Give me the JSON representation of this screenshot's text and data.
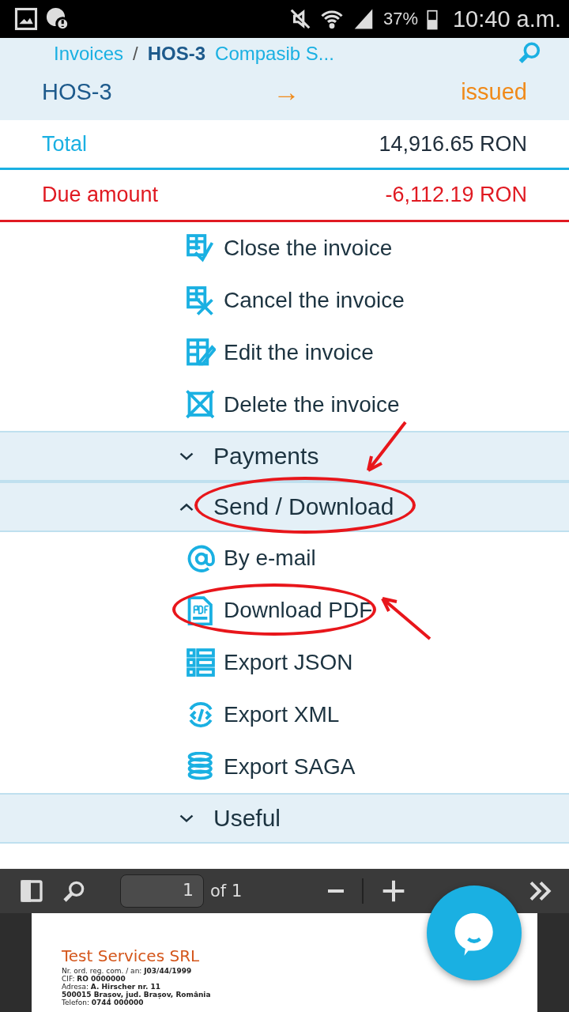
{
  "status_bar": {
    "battery": "37%",
    "time": "10:40 a.m."
  },
  "breadcrumb": {
    "parent": "Invoices",
    "separator": "/",
    "number": "HOS-3",
    "client": "Compasib S..."
  },
  "invoice": {
    "number": "HOS-3",
    "arrow": "→",
    "status": "issued"
  },
  "totals": [
    {
      "kind": "total",
      "label": "Total",
      "value": "14,916.65 RON"
    },
    {
      "kind": "due",
      "label": "Due amount",
      "value": "-6,112.19 RON"
    }
  ],
  "actions": [
    {
      "label": "Close the invoice"
    },
    {
      "label": "Cancel the invoice"
    },
    {
      "label": "Edit the invoice"
    },
    {
      "label": "Delete the invoice"
    }
  ],
  "sections": [
    {
      "title": "Payments",
      "expanded": false,
      "highlighted": false
    },
    {
      "title": "Send / Download",
      "expanded": true,
      "highlighted": true,
      "items": [
        {
          "label": "By e-mail",
          "highlighted": false
        },
        {
          "label": "Download PDF",
          "highlighted": true
        },
        {
          "label": "Export JSON",
          "highlighted": false
        },
        {
          "label": "Export XML",
          "highlighted": false
        },
        {
          "label": "Export SAGA",
          "highlighted": false
        }
      ]
    },
    {
      "title": "Useful",
      "expanded": false,
      "highlighted": false
    }
  ],
  "pdf_viewer": {
    "page": "1",
    "of": "of 1",
    "company": "Test Services SRL",
    "lines": [
      "Nr. ord. reg. com. / an: **J03/44/1999**",
      "CIF: **RO 0000000**",
      "Adresa: **A. Hirscher nr. 11**",
      "**500015 Brașov, jud. Brașov, România**",
      "Telefon: **0744 000000**"
    ]
  }
}
